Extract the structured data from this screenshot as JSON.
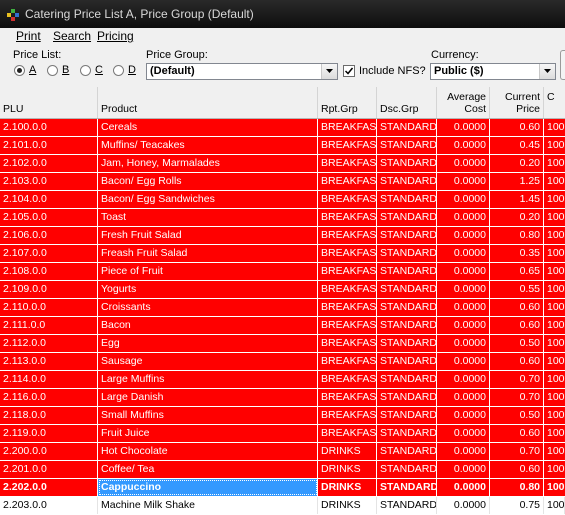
{
  "window": {
    "title": "Catering Price List A, Price Group (Default)",
    "app_icon": "catering-app-icon"
  },
  "menu": [
    {
      "label": "Print"
    },
    {
      "label": "Search"
    },
    {
      "label": "Pricing"
    }
  ],
  "toolbar": {
    "price_list_label": "Price List:",
    "price_list_options": [
      "A",
      "B",
      "C",
      "D"
    ],
    "price_list_selected": "A",
    "price_group_label": "Price Group:",
    "price_group_value": "(Default)",
    "include_nfs_label": "Include NFS?",
    "include_nfs_checked": true,
    "currency_label": "Currency:",
    "currency_value": "Public ($)"
  },
  "table": {
    "columns": [
      "PLU",
      "Product",
      "Rpt.Grp",
      "Dsc.Grp",
      "Average Cost",
      "Current Price",
      "C"
    ],
    "columns_display": {
      "avg_line1": "Average",
      "avg_line2": "Cost",
      "cur_line1": "Current",
      "cur_line2": "Price"
    },
    "rows": [
      {
        "plu": "2.100.0.0",
        "product": "Cereals",
        "rpt": "BREAKFAST",
        "dsc": "STANDARD",
        "avg": "0.0000",
        "price": "0.60",
        "next": "100"
      },
      {
        "plu": "2.101.0.0",
        "product": "Muffins/ Teacakes",
        "rpt": "BREAKFAST",
        "dsc": "STANDARD",
        "avg": "0.0000",
        "price": "0.45",
        "next": "100"
      },
      {
        "plu": "2.102.0.0",
        "product": "Jam, Honey, Marmalades",
        "rpt": "BREAKFAST",
        "dsc": "STANDARD",
        "avg": "0.0000",
        "price": "0.20",
        "next": "100"
      },
      {
        "plu": "2.103.0.0",
        "product": "Bacon/ Egg Rolls",
        "rpt": "BREAKFAST",
        "dsc": "STANDARD",
        "avg": "0.0000",
        "price": "1.25",
        "next": "100"
      },
      {
        "plu": "2.104.0.0",
        "product": "Bacon/ Egg Sandwiches",
        "rpt": "BREAKFAST",
        "dsc": "STANDARD",
        "avg": "0.0000",
        "price": "1.45",
        "next": "100"
      },
      {
        "plu": "2.105.0.0",
        "product": "Toast",
        "rpt": "BREAKFAST",
        "dsc": "STANDARD",
        "avg": "0.0000",
        "price": "0.20",
        "next": "100"
      },
      {
        "plu": "2.106.0.0",
        "product": "Fresh Fruit Salad",
        "rpt": "BREAKFAST",
        "dsc": "STANDARD",
        "avg": "0.0000",
        "price": "0.80",
        "next": "100"
      },
      {
        "plu": "2.107.0.0",
        "product": "Freash Fruit Salad",
        "rpt": "BREAKFAST",
        "dsc": "STANDARD",
        "avg": "0.0000",
        "price": "0.35",
        "next": "100"
      },
      {
        "plu": "2.108.0.0",
        "product": "Piece of Fruit",
        "rpt": "BREAKFAST",
        "dsc": "STANDARD",
        "avg": "0.0000",
        "price": "0.65",
        "next": "100"
      },
      {
        "plu": "2.109.0.0",
        "product": "Yogurts",
        "rpt": "BREAKFAST",
        "dsc": "STANDARD",
        "avg": "0.0000",
        "price": "0.55",
        "next": "100"
      },
      {
        "plu": "2.110.0.0",
        "product": "Croissants",
        "rpt": "BREAKFAST",
        "dsc": "STANDARD",
        "avg": "0.0000",
        "price": "0.60",
        "next": "100"
      },
      {
        "plu": "2.111.0.0",
        "product": "Bacon",
        "rpt": "BREAKFAST",
        "dsc": "STANDARD",
        "avg": "0.0000",
        "price": "0.60",
        "next": "100"
      },
      {
        "plu": "2.112.0.0",
        "product": "Egg",
        "rpt": "BREAKFAST",
        "dsc": "STANDARD",
        "avg": "0.0000",
        "price": "0.50",
        "next": "100"
      },
      {
        "plu": "2.113.0.0",
        "product": "Sausage",
        "rpt": "BREAKFAST",
        "dsc": "STANDARD",
        "avg": "0.0000",
        "price": "0.60",
        "next": "100"
      },
      {
        "plu": "2.114.0.0",
        "product": "Large Muffins",
        "rpt": "BREAKFAST",
        "dsc": "STANDARD",
        "avg": "0.0000",
        "price": "0.70",
        "next": "100"
      },
      {
        "plu": "2.116.0.0",
        "product": "Large Danish",
        "rpt": "BREAKFAST",
        "dsc": "STANDARD",
        "avg": "0.0000",
        "price": "0.70",
        "next": "100"
      },
      {
        "plu": "2.118.0.0",
        "product": "Small Muffins",
        "rpt": "BREAKFAST",
        "dsc": "STANDARD",
        "avg": "0.0000",
        "price": "0.50",
        "next": "100"
      },
      {
        "plu": "2.119.0.0",
        "product": "Fruit Juice",
        "rpt": "BREAKFAST",
        "dsc": "STANDARD",
        "avg": "0.0000",
        "price": "0.60",
        "next": "100"
      },
      {
        "plu": "2.200.0.0",
        "product": "Hot Chocolate",
        "rpt": "DRINKS",
        "dsc": "STANDARD",
        "avg": "0.0000",
        "price": "0.70",
        "next": "100"
      },
      {
        "plu": "2.201.0.0",
        "product": "Coffee/ Tea",
        "rpt": "DRINKS",
        "dsc": "STANDARD",
        "avg": "0.0000",
        "price": "0.60",
        "next": "100"
      },
      {
        "plu": "2.202.0.0",
        "product": "Cappuccino",
        "rpt": "DRINKS",
        "dsc": "STANDARD",
        "avg": "0.0000",
        "price": "0.80",
        "next": "100"
      },
      {
        "plu": "2.203.0.0",
        "product": "Machine Milk Shake",
        "rpt": "DRINKS",
        "dsc": "STANDARD",
        "avg": "0.0000",
        "price": "0.75",
        "next": "100"
      }
    ],
    "selected_index": 20,
    "colors": {
      "row_red": "#ff0000",
      "selection_blue": "#3399ff",
      "plain_row": "#ffffff"
    },
    "red_rows_count_comment_free": 21
  }
}
